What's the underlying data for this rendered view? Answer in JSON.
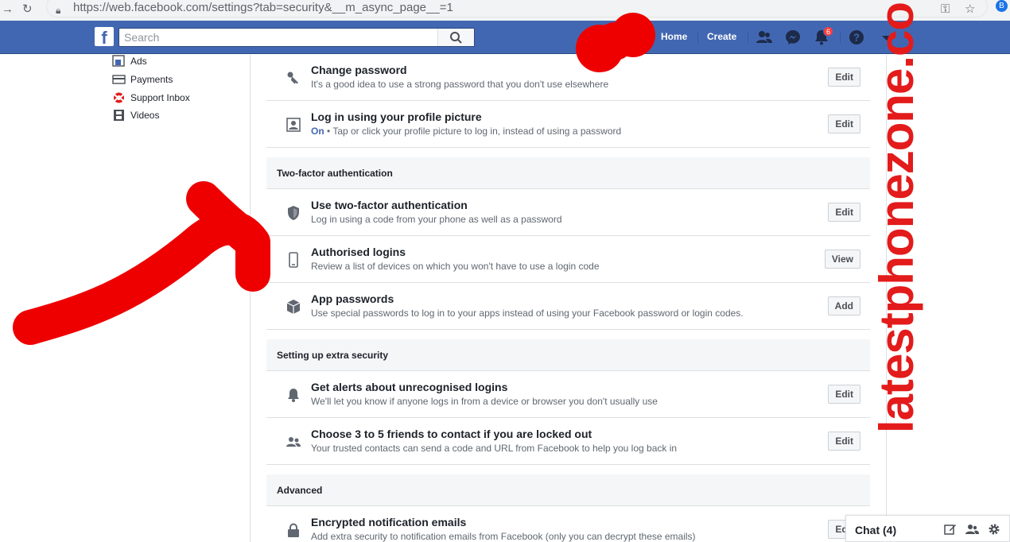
{
  "browser": {
    "url": "https://web.facebook.com/settings?tab=security&__m_async_page__=1",
    "profile_initial": "B"
  },
  "nav": {
    "logo": "f",
    "search_placeholder": "Search",
    "home": "Home",
    "create": "Create",
    "notifications_count": "6"
  },
  "left": {
    "items": [
      {
        "label": "Ads",
        "icon": "ads-icon"
      },
      {
        "label": "Payments",
        "icon": "credit-card-icon"
      },
      {
        "label": "Support Inbox",
        "icon": "lifebuoy-icon"
      },
      {
        "label": "Videos",
        "icon": "film-icon"
      }
    ]
  },
  "settings": {
    "change_password": {
      "title": "Change password",
      "desc": "It's a good idea to use a strong password that you don't use elsewhere",
      "button": "Edit",
      "icon": "key-icon"
    },
    "profile_login": {
      "title": "Log in using your profile picture",
      "status": "On",
      "desc": " • Tap or click your profile picture to log in, instead of using a password",
      "button": "Edit",
      "icon": "profile-picture-icon"
    },
    "two_factor_heading": "Two-factor authentication",
    "use_2fa": {
      "title": "Use two-factor authentication",
      "desc": "Log in using a code from your phone as well as a password",
      "button": "Edit",
      "icon": "shield-icon"
    },
    "authorised_logins": {
      "title": "Authorised logins",
      "desc": "Review a list of devices on which you won't have to use a login code",
      "button": "View",
      "icon": "phone-icon"
    },
    "app_passwords": {
      "title": "App passwords",
      "desc": "Use special passwords to log in to your apps instead of using your Facebook password or login codes.",
      "button": "Add",
      "icon": "cube-icon"
    },
    "extra_security_heading": "Setting up extra security",
    "alerts": {
      "title": "Get alerts about unrecognised logins",
      "desc": "We'll let you know if anyone logs in from a device or browser you don't usually use",
      "button": "Edit",
      "icon": "bell-icon"
    },
    "trusted_contacts": {
      "title": "Choose 3 to 5 friends to contact if you are locked out",
      "desc": "Your trusted contacts can send a code and URL from Facebook to help you log back in",
      "button": "Edit",
      "icon": "friends-icon"
    },
    "advanced_heading": "Advanced",
    "encrypted_emails": {
      "title": "Encrypted notification emails",
      "desc": "Add extra security to notification emails from Facebook (only you can decrypt these emails)",
      "button": "Edit",
      "icon": "lock-icon"
    }
  },
  "chat": {
    "label": "Chat (4)"
  },
  "watermark": "latestphonezone.com",
  "colors": {
    "brand": "#4267b2",
    "annotation": "#e31b1b"
  }
}
